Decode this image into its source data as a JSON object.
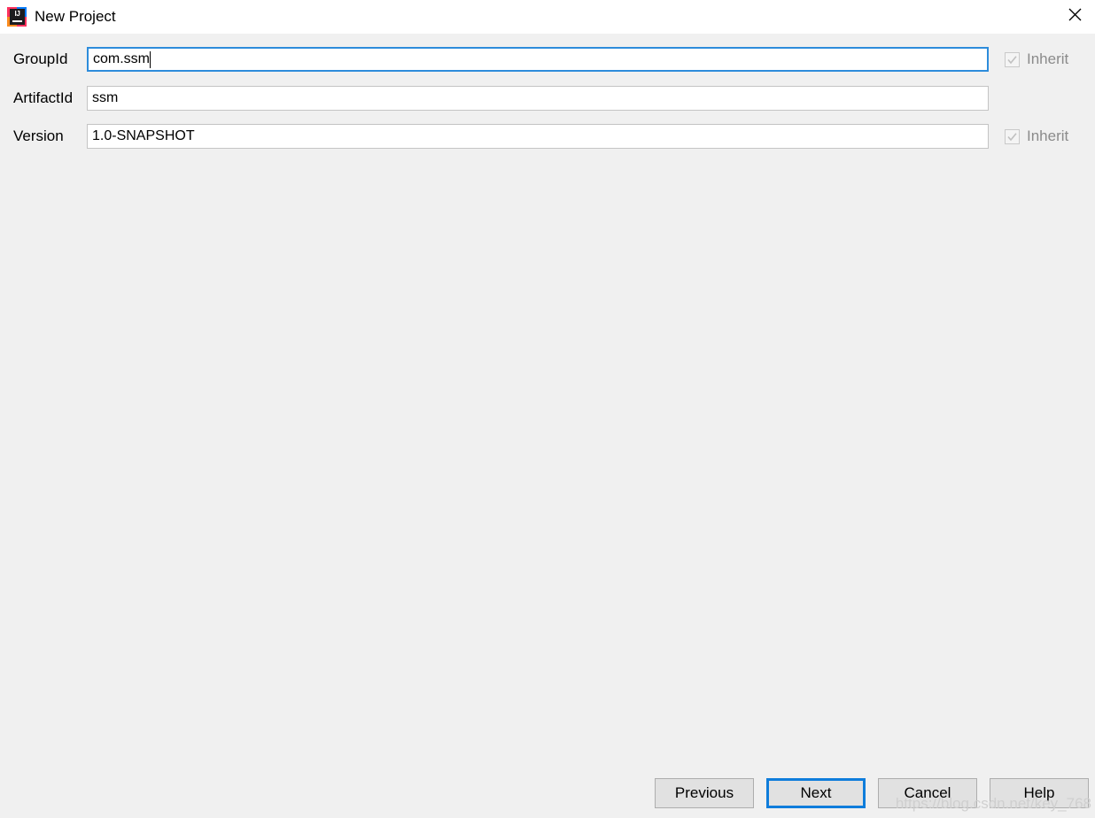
{
  "window": {
    "title": "New Project",
    "app_icon": "intellij-idea-icon",
    "icon_text": "IJ",
    "close_icon": "close-icon",
    "accent_color": "#0f7ddb",
    "focus_border_color": "#2d8cdb",
    "background_color": "#f0f0f0",
    "titlebar_color": "#ffffff"
  },
  "form": {
    "fields": [
      {
        "label": "GroupId",
        "value": "com.ssm",
        "focused": true,
        "has_inherit": true,
        "inherit_label": "Inherit",
        "inherit_checked": true,
        "inherit_enabled": false
      },
      {
        "label": "ArtifactId",
        "value": "ssm",
        "focused": false,
        "has_inherit": false,
        "inherit_label": "",
        "inherit_checked": false,
        "inherit_enabled": false
      },
      {
        "label": "Version",
        "value": "1.0-SNAPSHOT",
        "focused": false,
        "has_inherit": true,
        "inherit_label": "Inherit",
        "inherit_checked": true,
        "inherit_enabled": false
      }
    ]
  },
  "buttons": {
    "previous": "Previous",
    "next": "Next",
    "cancel": "Cancel",
    "help": "Help"
  },
  "watermark": {
    "text": "https://blog.csdn.net/key_768"
  }
}
